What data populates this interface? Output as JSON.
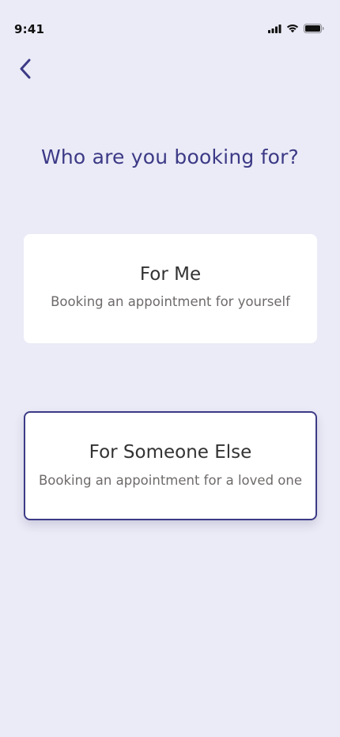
{
  "status_bar": {
    "time": "9:41",
    "icons": [
      "cellular-signal-icon",
      "wifi-icon",
      "battery-icon"
    ]
  },
  "header": {
    "back_icon": "chevron-left-icon"
  },
  "main": {
    "title": "Who are you booking for?",
    "options": [
      {
        "title": "For Me",
        "subtitle": "Booking an appointment for yourself",
        "selected": false
      },
      {
        "title": "For Someone Else",
        "subtitle": "Booking an appointment for a loved one",
        "selected": true
      }
    ]
  },
  "colors": {
    "background": "#EBEBF7",
    "accent": "#3C3A86",
    "card": "#FFFFFF",
    "card_title": "#333333",
    "card_subtitle": "#6E6A6A"
  }
}
